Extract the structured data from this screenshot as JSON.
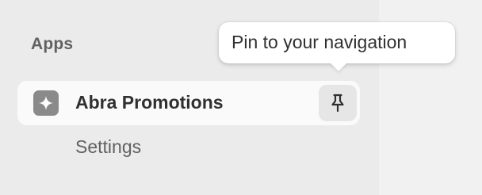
{
  "sidebar": {
    "section_heading": "Apps",
    "app": {
      "name": "Abra Promotions",
      "icon": "sparkle-icon",
      "pin_icon": "pin-icon"
    },
    "sub_items": [
      {
        "label": "Settings"
      }
    ]
  },
  "tooltip": {
    "text": "Pin to your navigation"
  },
  "colors": {
    "sidebar_bg": "#ebebeb",
    "right_pane_bg": "#f1f1f1",
    "selected_item_bg": "#fafafa",
    "app_icon_bg": "#8a8a8a",
    "pin_button_bg": "#e6e6e6",
    "text_primary": "#303030",
    "text_secondary": "#616161"
  }
}
